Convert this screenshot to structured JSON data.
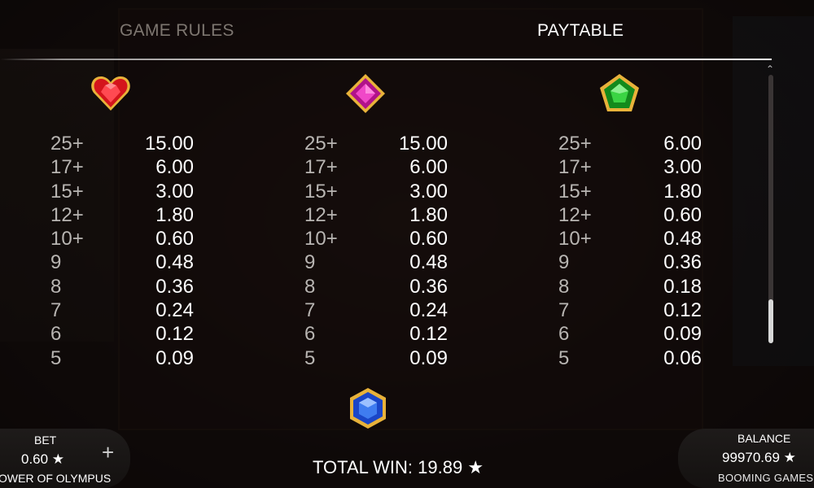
{
  "tabs": {
    "game_rules": "GAME RULES",
    "paytable": "PAYTABLE"
  },
  "paytable": {
    "columns": [
      {
        "symbol": "red-heart-gem-icon",
        "color": "#d4141c",
        "rows": [
          {
            "count": "25+",
            "pay": "15.00"
          },
          {
            "count": "17+",
            "pay": "6.00"
          },
          {
            "count": "15+",
            "pay": "3.00"
          },
          {
            "count": "12+",
            "pay": "1.80"
          },
          {
            "count": "10+",
            "pay": "0.60"
          },
          {
            "count": "9",
            "pay": "0.48"
          },
          {
            "count": "8",
            "pay": "0.36"
          },
          {
            "count": "7",
            "pay": "0.24"
          },
          {
            "count": "6",
            "pay": "0.12"
          },
          {
            "count": "5",
            "pay": "0.09"
          }
        ]
      },
      {
        "symbol": "pink-diamond-gem-icon",
        "color": "#e01fb0",
        "rows": [
          {
            "count": "25+",
            "pay": "15.00"
          },
          {
            "count": "17+",
            "pay": "6.00"
          },
          {
            "count": "15+",
            "pay": "3.00"
          },
          {
            "count": "12+",
            "pay": "1.80"
          },
          {
            "count": "10+",
            "pay": "0.60"
          },
          {
            "count": "9",
            "pay": "0.48"
          },
          {
            "count": "8",
            "pay": "0.36"
          },
          {
            "count": "7",
            "pay": "0.24"
          },
          {
            "count": "6",
            "pay": "0.12"
          },
          {
            "count": "5",
            "pay": "0.09"
          }
        ]
      },
      {
        "symbol": "green-pentagon-gem-icon",
        "color": "#1fa82a",
        "rows": [
          {
            "count": "25+",
            "pay": "6.00"
          },
          {
            "count": "17+",
            "pay": "3.00"
          },
          {
            "count": "15+",
            "pay": "1.80"
          },
          {
            "count": "12+",
            "pay": "0.60"
          },
          {
            "count": "10+",
            "pay": "0.48"
          },
          {
            "count": "9",
            "pay": "0.36"
          },
          {
            "count": "8",
            "pay": "0.18"
          },
          {
            "count": "7",
            "pay": "0.12"
          },
          {
            "count": "6",
            "pay": "0.09"
          },
          {
            "count": "5",
            "pay": "0.06"
          }
        ]
      }
    ],
    "next_symbol": "blue-hexagon-gem-icon"
  },
  "bottom": {
    "bet_label": "BET",
    "bet_value": "0.60 ★",
    "plus_label": "+",
    "game_name": "OWER OF OLYMPUS",
    "total_win": "TOTAL WIN: 19.89 ★",
    "balance_label": "BALANCE",
    "balance_value": "99970.69 ★",
    "provider": "BOOMING GAMES"
  },
  "colors": {
    "accent_white": "#ffffff",
    "inactive_tab": "#7d7670",
    "count_text": "#b8b5b2"
  }
}
